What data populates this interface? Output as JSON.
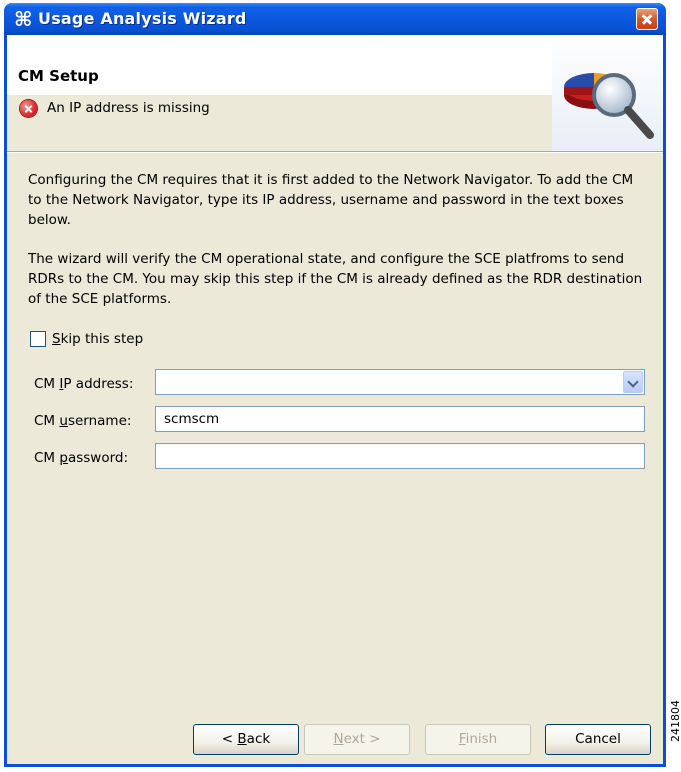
{
  "window": {
    "title": "Usage Analysis Wizard",
    "title_icon": "wizard-glyph-icon"
  },
  "header": {
    "page_title": "CM Setup",
    "message": "An IP address is missing",
    "message_icon": "error-icon",
    "banner_icon": "pie-chart-magnifier-icon"
  },
  "body": {
    "paragraph1": "Configuring the CM requires that it is first added to the Network Navigator. To add the CM to the Network Navigator, type its IP address, username and password in the text boxes below.",
    "paragraph2": "The wizard will verify the CM operational state, and configure the SCE platfroms to send RDRs to the CM. You may skip this step if the CM is already defined as the RDR destination of the SCE platforms."
  },
  "skip": {
    "label_mnemonic": "S",
    "label_rest": "kip this step",
    "checked": false
  },
  "form": {
    "ip": {
      "label_pre": "CM ",
      "label_mnemonic": "I",
      "label_post": "P address:",
      "value": ""
    },
    "username": {
      "label_pre": "CM ",
      "label_mnemonic": "u",
      "label_post": "sername:",
      "value": "scmscm"
    },
    "password": {
      "label_pre": "CM ",
      "label_mnemonic": "p",
      "label_post": "assword:",
      "value": ""
    }
  },
  "buttons": {
    "back": {
      "pre": "< ",
      "mnemonic": "B",
      "post": "ack"
    },
    "next": {
      "mnemonic": "N",
      "post": "ext >"
    },
    "finish": {
      "mnemonic": "F",
      "post": "inish"
    },
    "cancel": "Cancel"
  },
  "side_code": "241804",
  "colors": {
    "titlebar": "#0A58DE",
    "client": "#ECE9D8",
    "error": "#D62D2D"
  }
}
